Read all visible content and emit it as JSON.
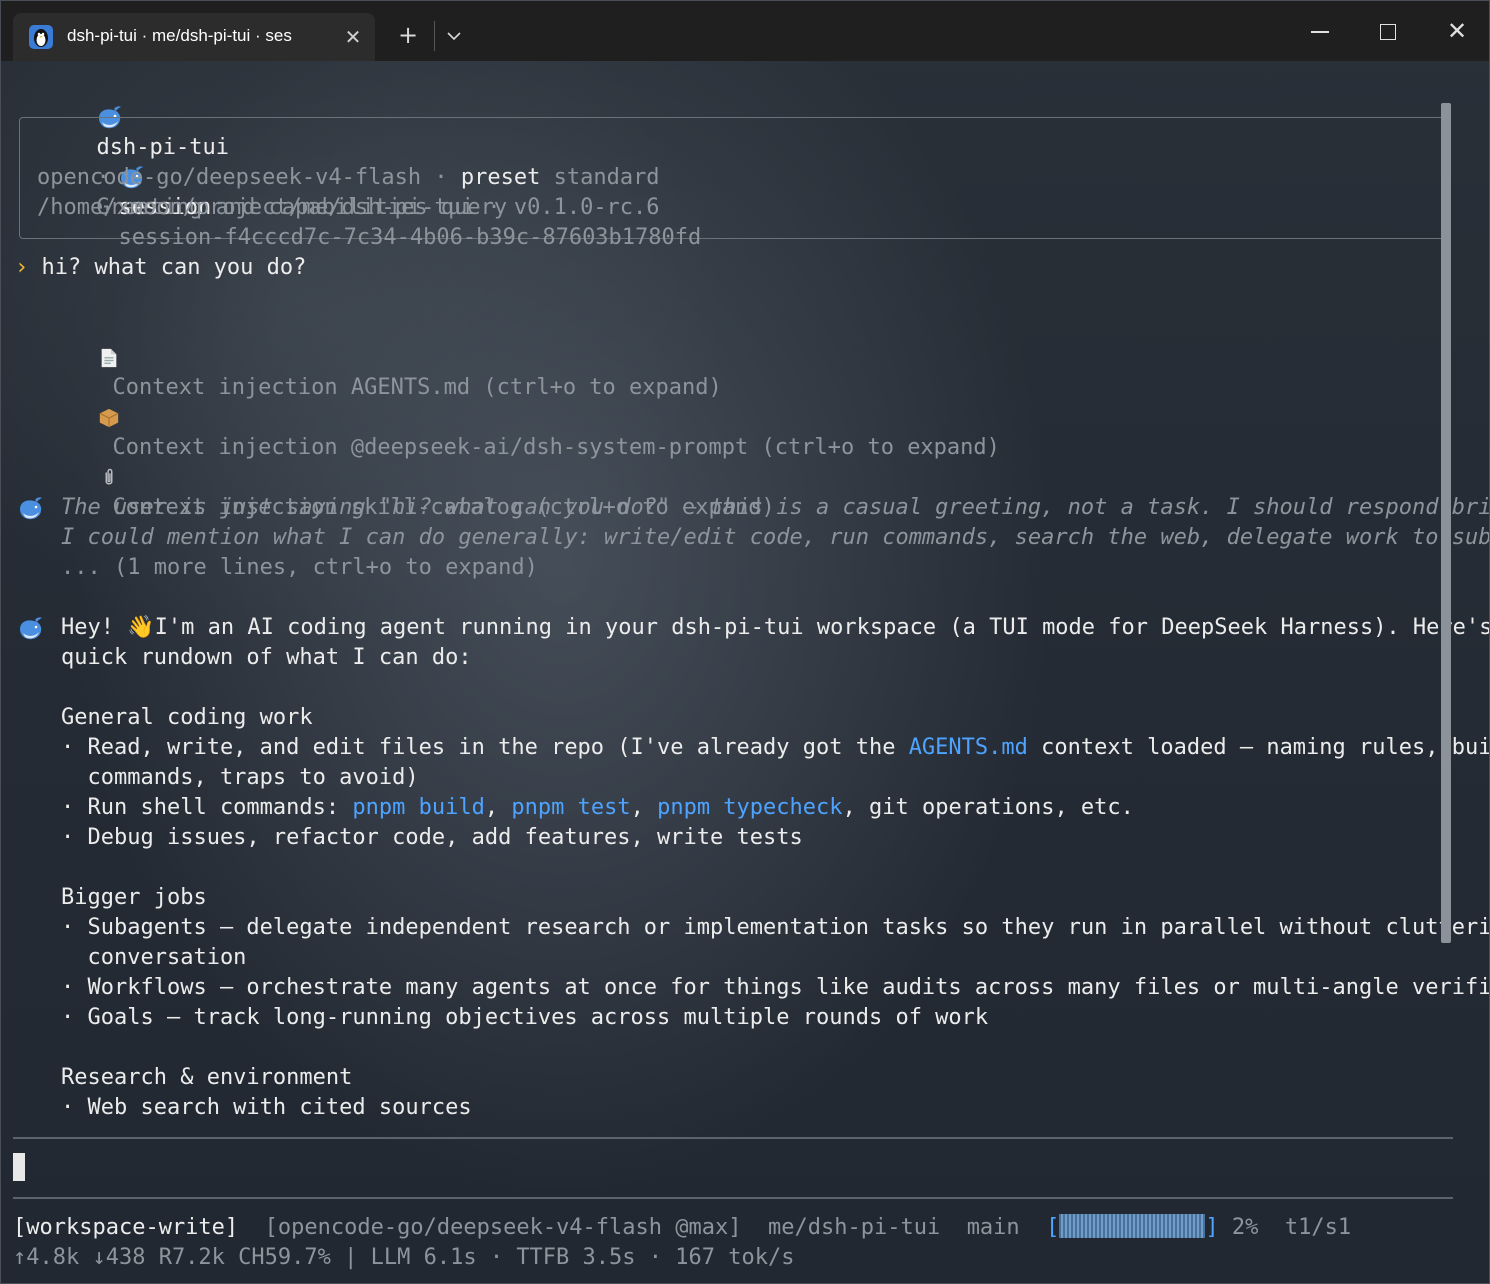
{
  "window": {
    "tab_title": "dsh-pi-tui · me/dsh-pi-tui · ses",
    "new_tab": "+",
    "dropdown": "⌄",
    "close_tab": "✕",
    "close": "✕"
  },
  "header": {
    "app": "dsh-pi-tui",
    "sep": "·",
    "subtitle": "Greeting and capabilities query"
  },
  "session": {
    "label": "session",
    "id": "session-f4cccd7c-7c34-4b06-b39c-87603b1780fd",
    "model": "opencode-go/deepseek-v4-flash",
    "sep": "·",
    "preset_label": "preset",
    "preset": "standard",
    "path": "/home/xmoon/project/me/dsh-pi-tui",
    "version": "v0.1.0-rc.6"
  },
  "prompt": {
    "marker": "›",
    "text": "hi? what can you do?"
  },
  "context": [
    {
      "icon": "document-icon",
      "text": "Context injection AGENTS.md (ctrl+o to expand)"
    },
    {
      "icon": "package-icon",
      "text": "Context injection @deepseek-ai/dsh-system-prompt (ctrl+o to expand)"
    },
    {
      "icon": "paperclip-icon",
      "text": "Context injection skill-catalog (ctrl+o to expand)"
    }
  ],
  "thinking": {
    "line1": "The user is just saying \"hi? what can you do?\" — this is a casual greeting, not a task. I should respond briefly an…",
    "line2": "I could mention what I can do generally: write/edit code, run commands, search the web, delegate work to subagents,…",
    "line3": "... (1 more lines, ctrl+o to expand)"
  },
  "response": {
    "intro1_a": "Hey! ",
    "wave": "👋",
    "intro1_b": "I'm an AI coding agent running in your dsh-pi-tui workspace (a TUI mode for DeepSeek Harness). Here's a",
    "intro2": "quick rundown of what I can do:",
    "sec1_title": "General coding work",
    "sec1_b1_a": "· Read, write, and edit files in the repo (I've already got the ",
    "sec1_b1_link": "AGENTS.md",
    "sec1_b1_b": " context loaded — naming rules, build/test",
    "sec1_b1_c": "  commands, traps to avoid)",
    "sec1_b2_a": "· Run shell commands: ",
    "sec1_b2_c1": "pnpm build",
    "sec1_b2_comma1": ", ",
    "sec1_b2_c2": "pnpm test",
    "sec1_b2_comma2": ", ",
    "sec1_b2_c3": "pnpm typecheck",
    "sec1_b2_b": ", git operations, etc.",
    "sec1_b3": "· Debug issues, refactor code, add features, write tests",
    "sec2_title": "Bigger jobs",
    "sec2_b1_a": "· Subagents — delegate independent research or implementation tasks so they run in parallel without cluttering our",
    "sec2_b1_b": "  conversation",
    "sec2_b2": "· Workflows — orchestrate many agents at once for things like audits across many files or multi-angle verification",
    "sec2_b3": "· Goals — track long-running objectives across multiple rounds of work",
    "sec3_title": "Research & environment",
    "sec3_b1": "· Web search with cited sources"
  },
  "status": {
    "mode": "[workspace-write]",
    "model": "[opencode-go/deepseek-v4-flash @max]",
    "repo": "me/dsh-pi-tui",
    "branch": "main",
    "bracket_open": "[",
    "bracket_close": "]",
    "progress_percent": 2,
    "progress_label": "2%",
    "turn": "t1/s1",
    "stats": "↑4.8k ↓438 R7.2k CH59.7% | LLM 6.1s · TTFB 3.5s · 167 tok/s"
  },
  "colors": {
    "accent": "#4ea3ff",
    "dim": "#8d949c",
    "text": "#ececec",
    "prompt_marker": "#f5b82e"
  }
}
